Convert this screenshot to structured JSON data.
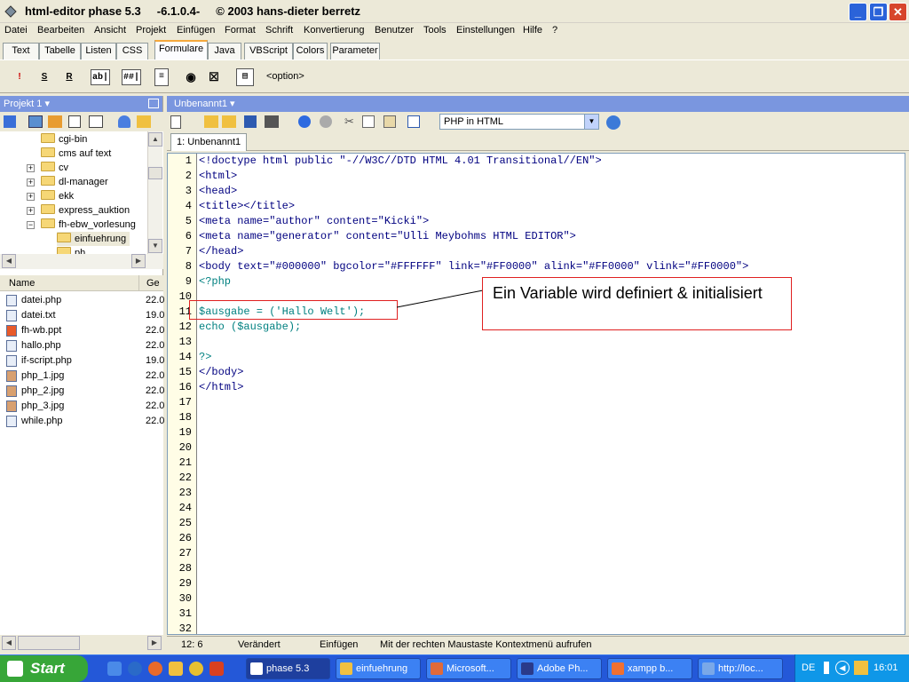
{
  "window": {
    "title": "html-editor phase 5.3     -6.1.0.4-     © 2003 hans-dieter berretz",
    "minimize_icon": "minimize-icon",
    "maximize_icon": "restore-icon",
    "close_icon": "close-icon"
  },
  "menu": [
    "Datei",
    "Bearbeiten",
    "Ansicht",
    "Projekt",
    "Einfügen",
    "Format",
    "Schrift",
    "Konvertierung",
    "Benutzer",
    "Tools",
    "Einstellungen",
    "Hilfe",
    "?"
  ],
  "tabs": [
    "Text",
    "Tabelle",
    "Listen",
    "CSS",
    "Formulare",
    "Java",
    "VBScript",
    "Colors",
    "Parameter"
  ],
  "active_tab": "Formulare",
  "form_toolbar": {
    "items": [
      "!",
      "S",
      "R",
      "ab|",
      "##|",
      "≡",
      "◉",
      "☒",
      "▤"
    ],
    "option_label": "<option>"
  },
  "left_panel": {
    "project_title": "Projekt 1",
    "tree": [
      {
        "label": "cgi-bin",
        "expander": ""
      },
      {
        "label": "cms auf text",
        "expander": ""
      },
      {
        "label": "cv",
        "expander": "+"
      },
      {
        "label": "dl-manager",
        "expander": "+"
      },
      {
        "label": "ekk",
        "expander": "+"
      },
      {
        "label": "express_auktion",
        "expander": "+"
      },
      {
        "label": "fh-ebw_vorlesung",
        "expander": "−"
      },
      {
        "label": "einfuehrung",
        "expander": ""
      },
      {
        "label": "ph",
        "expander": ""
      }
    ],
    "file_columns": [
      "Name",
      "Ge"
    ],
    "files": [
      {
        "name": "datei.php",
        "date": "22.0"
      },
      {
        "name": "datei.txt",
        "date": "19.0"
      },
      {
        "name": "fh-wb.ppt",
        "date": "22.0"
      },
      {
        "name": "hallo.php",
        "date": "22.0"
      },
      {
        "name": "if-script.php",
        "date": "19.0"
      },
      {
        "name": "php_1.jpg",
        "date": "22.0"
      },
      {
        "name": "php_2.jpg",
        "date": "22.0"
      },
      {
        "name": "php_3.jpg",
        "date": "22.0"
      },
      {
        "name": "while.php",
        "date": "22.0"
      }
    ]
  },
  "editor": {
    "doc_title": "Unbenannt1",
    "doc_tab": "1: Unbenannt1",
    "mode_combo": "PHP in HTML",
    "line_numbers": [
      "1",
      "2",
      "3",
      "4",
      "5",
      "6",
      "7",
      "8",
      "9",
      "10",
      "11",
      "12",
      "13",
      "14",
      "15",
      "16",
      "17",
      "18",
      "19",
      "20",
      "21",
      "22",
      "23",
      "24",
      "25",
      "26",
      "27",
      "28",
      "29",
      "30",
      "31",
      "32"
    ],
    "lines": [
      "<!doctype html public \"-//W3C//DTD HTML 4.01 Transitional//EN\">",
      "<html>",
      "<head>",
      "<title></title>",
      "<meta name=\"author\" content=\"Kicki\">",
      "<meta name=\"generator\" content=\"Ulli Meybohms HTML EDITOR\">",
      "</head>",
      "<body text=\"#000000\" bgcolor=\"#FFFFFF\" link=\"#FF0000\" alink=\"#FF0000\" vlink=\"#FF0000\">",
      "<?php",
      "",
      "$ausgabe = ('Hallo Welt');",
      "echo ($ausgabe);",
      "",
      "?>",
      "</body>",
      "</html>"
    ]
  },
  "annotation": {
    "text": "Ein Variable wird definiert & initialisiert"
  },
  "status": {
    "position": "12: 6",
    "modified": "Verändert",
    "mode": "Einfügen",
    "hint": "Mit der rechten Maustaste Kontextmenü aufrufen"
  },
  "taskbar": {
    "start": "Start",
    "buttons": [
      "phase 5.3",
      "einfuehrung",
      "Microsoft...",
      "Adobe Ph...",
      "xampp b...",
      "http://loc..."
    ],
    "lang": "DE",
    "clock": "16:01"
  },
  "colors": {
    "html_tag": "#000080",
    "php_code": "#008080",
    "annotation_border": "#e02020",
    "panel_header": "#7a96df"
  }
}
